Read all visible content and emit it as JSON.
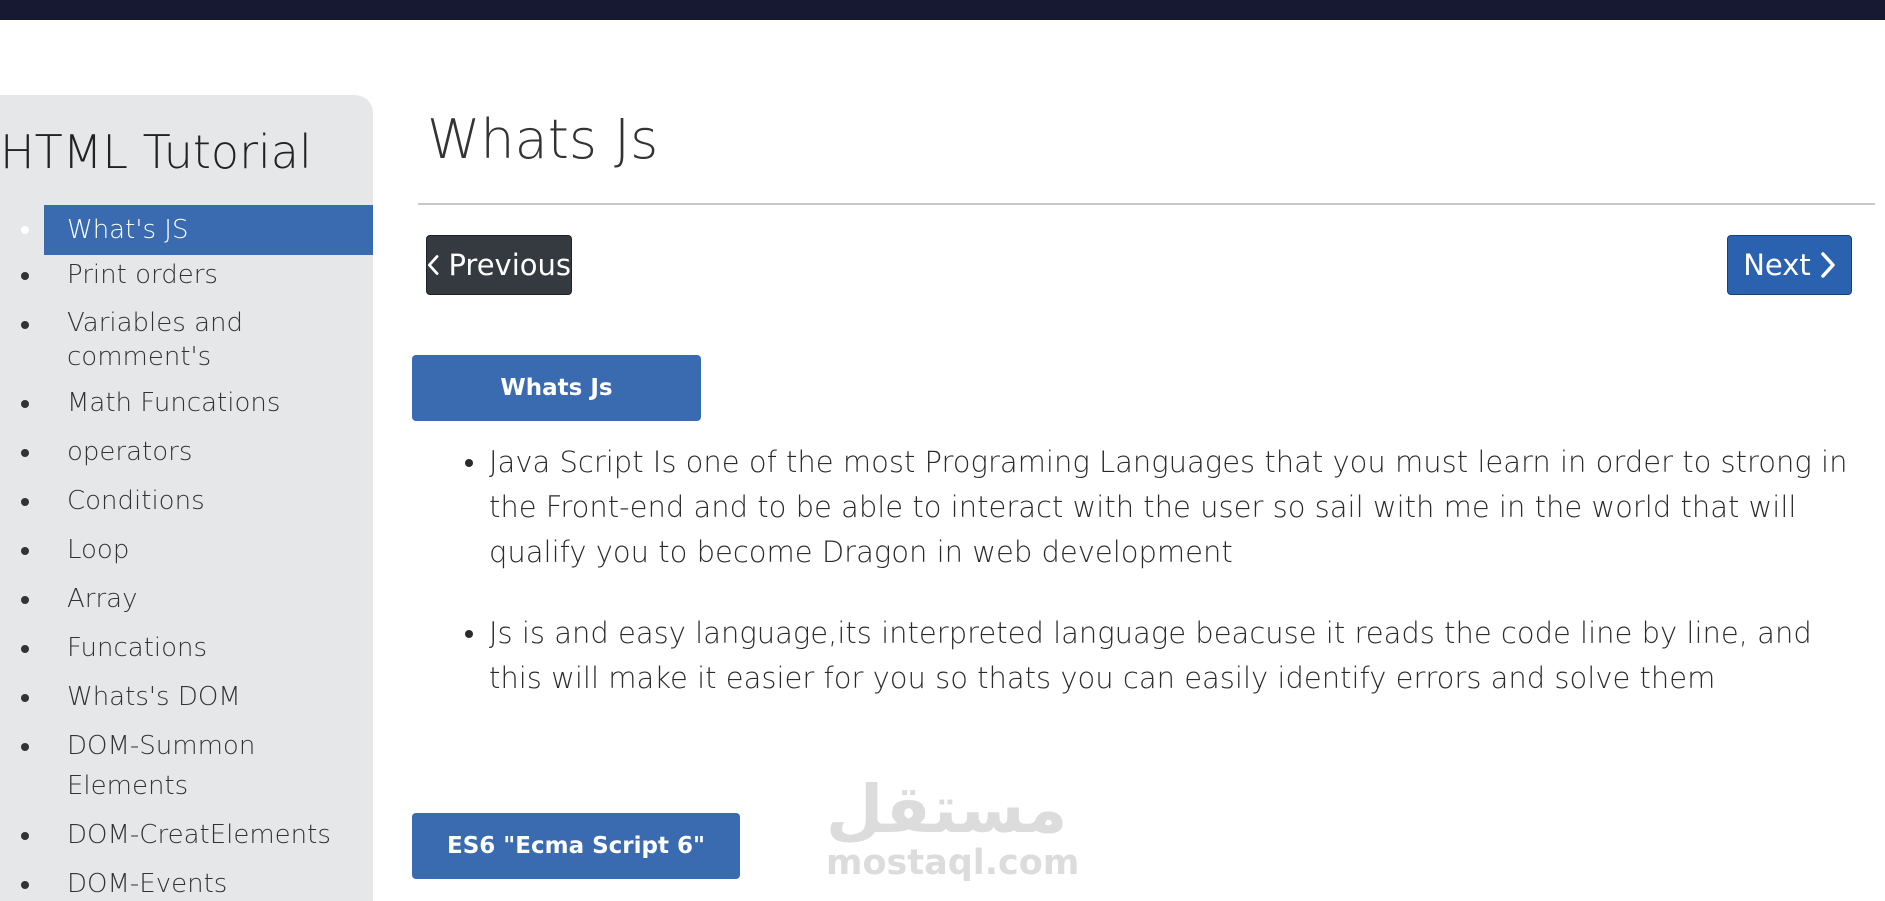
{
  "sidebar": {
    "title": "HTML Tutorial",
    "items": [
      {
        "label": "What's JS",
        "active": true
      },
      {
        "label": "Print orders"
      },
      {
        "label": "Variables and comment's"
      },
      {
        "label": "Math Funcations"
      },
      {
        "label": "operators"
      },
      {
        "label": "Conditions"
      },
      {
        "label": "Loop"
      },
      {
        "label": "Array"
      },
      {
        "label": "Funcations"
      },
      {
        "label": "Whats's DOM"
      },
      {
        "label": "DOM-Summon Elements"
      },
      {
        "label": "DOM-CreatElements"
      },
      {
        "label": "DOM-Events"
      }
    ]
  },
  "main": {
    "title": "Whats Js",
    "nav": {
      "previous_label": "Previous",
      "next_label": "Next"
    },
    "section1": {
      "button_label": "Whats Js",
      "points": [
        "Java Script Is one of the most Programing Languages that you must learn in order to strong in the Front-end and to be able to interact with the user so sail with me in the world that will qualify you to become Dragon in web development",
        "Js is and easy language,its interpreted language beacuse it reads the code line by line, and this will make it easier for you so thats you can easily identify errors and solve them"
      ]
    },
    "section2": {
      "button_label": "ES6 \"Ecma Script 6\""
    }
  },
  "watermark": {
    "arabic": "مستقل",
    "domain": "mostaql.com"
  },
  "icons": {
    "previous": "chevron-left-icon",
    "next": "chevron-right-icon"
  },
  "colors": {
    "topbar": "#161931",
    "accent": "#3a6bb1",
    "dark_button": "#343a40",
    "sidebar_bg": "#e6e7e9"
  }
}
